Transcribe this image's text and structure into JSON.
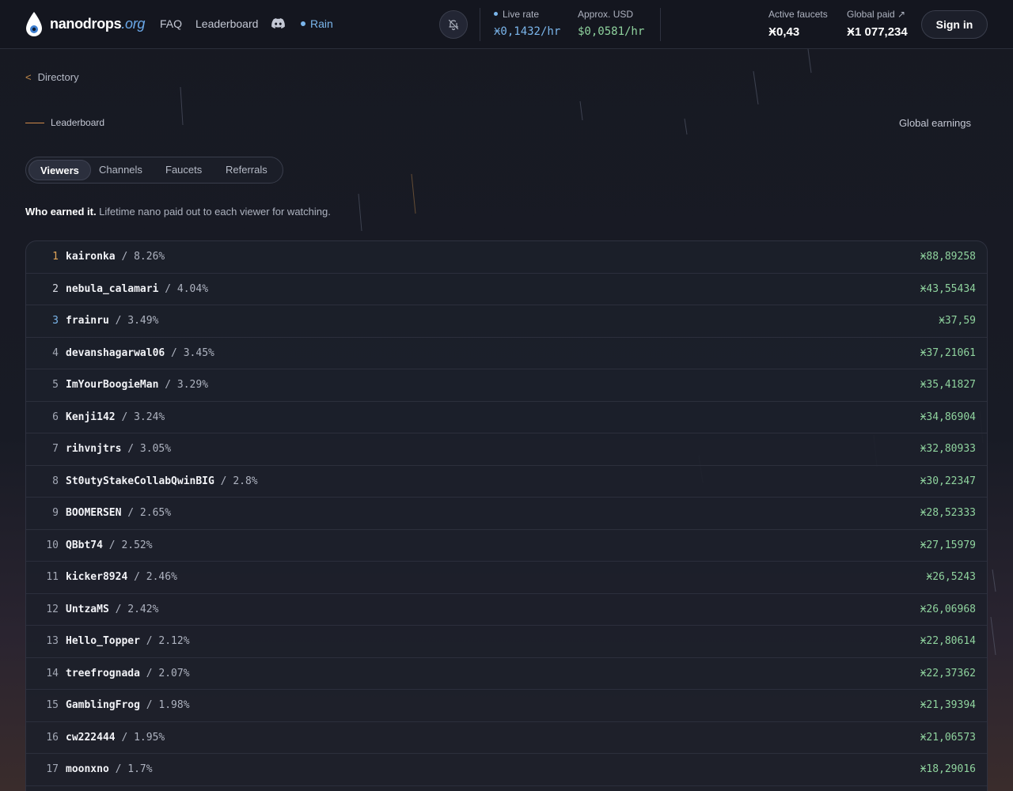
{
  "header": {
    "brand_name": "nanodrops",
    "brand_tld": ".org",
    "nav": {
      "faq": "FAQ",
      "leaderboard": "Leaderboard",
      "rain": "Rain"
    },
    "live_rate": {
      "label": "Live rate",
      "value": "Ӿ0,1432/hr"
    },
    "approx_usd": {
      "label": "Approx. USD",
      "value": "$0,0581/hr"
    },
    "active_faucets": {
      "label": "Active faucets",
      "value": "Ӿ0,43"
    },
    "global_paid": {
      "label": "Global paid ↗",
      "value": "Ӿ1 077,234"
    },
    "sign_in": "Sign in"
  },
  "back_link": "Directory",
  "section_title": "Leaderboard",
  "global_earnings": "Global earnings",
  "tabs": [
    "Viewers",
    "Channels",
    "Faucets",
    "Referrals"
  ],
  "active_tab": "Viewers",
  "description": {
    "bold": "Who earned it.",
    "text": " Lifetime nano paid out to each viewer for watching."
  },
  "leaderboard": [
    {
      "rank": "1",
      "name": "kaironka",
      "pct": " / 8.26%",
      "amount": "Ӿ88,89258"
    },
    {
      "rank": "2",
      "name": "nebula_calamari",
      "pct": " / 4.04%",
      "amount": "Ӿ43,55434"
    },
    {
      "rank": "3",
      "name": "frainru",
      "pct": " / 3.49%",
      "amount": "Ӿ37,59"
    },
    {
      "rank": "4",
      "name": "devanshagarwal06",
      "pct": " / 3.45%",
      "amount": "Ӿ37,21061"
    },
    {
      "rank": "5",
      "name": "ImYourBoogieMan",
      "pct": " / 3.29%",
      "amount": "Ӿ35,41827"
    },
    {
      "rank": "6",
      "name": "Kenji142",
      "pct": " / 3.24%",
      "amount": "Ӿ34,86904"
    },
    {
      "rank": "7",
      "name": "rihvnjtrs",
      "pct": " / 3.05%",
      "amount": "Ӿ32,80933"
    },
    {
      "rank": "8",
      "name": "St0utyStakeCollabQwinBIG",
      "pct": " / 2.8%",
      "amount": "Ӿ30,22347"
    },
    {
      "rank": "9",
      "name": "BOOMERSEN",
      "pct": " / 2.65%",
      "amount": "Ӿ28,52333"
    },
    {
      "rank": "10",
      "name": "QBbt74",
      "pct": " / 2.52%",
      "amount": "Ӿ27,15979"
    },
    {
      "rank": "11",
      "name": "kicker8924",
      "pct": " / 2.46%",
      "amount": "Ӿ26,5243"
    },
    {
      "rank": "12",
      "name": "UntzaMS",
      "pct": " / 2.42%",
      "amount": "Ӿ26,06968"
    },
    {
      "rank": "13",
      "name": "Hello_Topper",
      "pct": " / 2.12%",
      "amount": "Ӿ22,80614"
    },
    {
      "rank": "14",
      "name": "treefrognada",
      "pct": " / 2.07%",
      "amount": "Ӿ22,37362"
    },
    {
      "rank": "15",
      "name": "GamblingFrog",
      "pct": " / 1.98%",
      "amount": "Ӿ21,39394"
    },
    {
      "rank": "16",
      "name": "cw222444",
      "pct": " / 1.95%",
      "amount": "Ӿ21,06573"
    },
    {
      "rank": "17",
      "name": "moonxno",
      "pct": " / 1.7%",
      "amount": "Ӿ18,29016"
    }
  ],
  "colors": {
    "accent_blue": "#7bb6ec",
    "amount_green": "#8fd39e",
    "accent_orange": "#d08a4a",
    "background": "#171922"
  },
  "icons": [
    "droplet-logo-icon",
    "discord-icon",
    "bell-off-icon",
    "chevron-left-icon",
    "external-arrow-icon"
  ]
}
